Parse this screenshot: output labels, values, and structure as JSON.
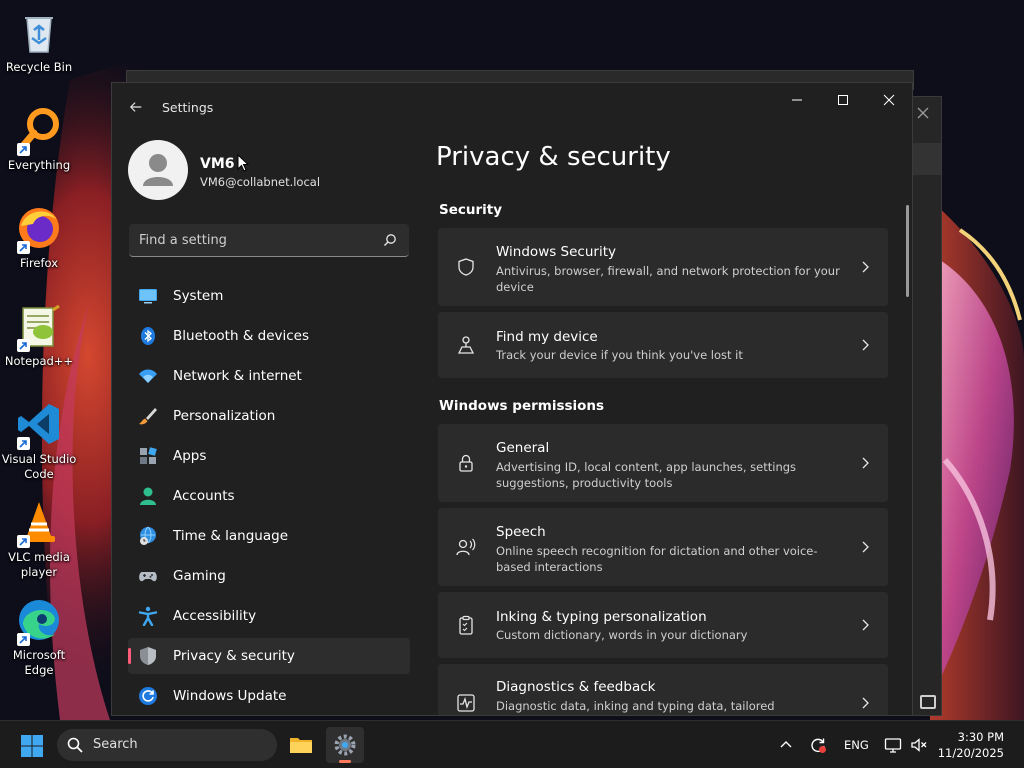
{
  "desktop": {
    "icons": [
      {
        "label": "Recycle Bin",
        "icon": "recycle-bin-icon"
      },
      {
        "label": "Everything",
        "icon": "everything-search-icon"
      },
      {
        "label": "Firefox",
        "icon": "firefox-icon"
      },
      {
        "label": "Notepad++",
        "icon": "notepad-plus-plus-icon"
      },
      {
        "label": "Visual Studio Code",
        "icon": "vscode-icon"
      },
      {
        "label": "VLC media player",
        "icon": "vlc-icon"
      },
      {
        "label": "Microsoft Edge",
        "icon": "edge-icon"
      }
    ]
  },
  "window": {
    "app_title": "Settings"
  },
  "profile": {
    "name": "VM6",
    "email": "VM6@collabnet.local"
  },
  "search": {
    "placeholder": "Find a setting"
  },
  "nav": {
    "items": [
      {
        "label": "System",
        "icon": "monitor-icon"
      },
      {
        "label": "Bluetooth & devices",
        "icon": "bluetooth-icon"
      },
      {
        "label": "Network & internet",
        "icon": "wifi-icon"
      },
      {
        "label": "Personalization",
        "icon": "brush-icon"
      },
      {
        "label": "Apps",
        "icon": "apps-icon"
      },
      {
        "label": "Accounts",
        "icon": "person-icon"
      },
      {
        "label": "Time & language",
        "icon": "globe-clock-icon"
      },
      {
        "label": "Gaming",
        "icon": "gamepad-icon"
      },
      {
        "label": "Accessibility",
        "icon": "accessibility-icon"
      },
      {
        "label": "Privacy & security",
        "icon": "shield-icon",
        "active": true
      },
      {
        "label": "Windows Update",
        "icon": "update-icon"
      }
    ],
    "active_accent": "#ff5c7a"
  },
  "content": {
    "title": "Privacy & security",
    "sections": [
      {
        "title": "Security",
        "cards": [
          {
            "title": "Windows Security",
            "desc": "Antivirus, browser, firewall, and network protection for your device",
            "icon": "shield-outline-icon"
          },
          {
            "title": "Find my device",
            "desc": "Track your device if you think you've lost it",
            "icon": "find-device-icon"
          }
        ]
      },
      {
        "title": "Windows permissions",
        "cards": [
          {
            "title": "General",
            "desc": "Advertising ID, local content, app launches, settings suggestions, productivity tools",
            "icon": "lock-icon"
          },
          {
            "title": "Speech",
            "desc": "Online speech recognition for dictation and other voice-based interactions",
            "icon": "speech-icon"
          },
          {
            "title": "Inking & typing personalization",
            "desc": "Custom dictionary, words in your dictionary",
            "icon": "clipboard-icon"
          },
          {
            "title": "Diagnostics & feedback",
            "desc": "Diagnostic data, inking and typing data, tailored experiences,",
            "icon": "diagnostics-icon"
          }
        ]
      }
    ]
  },
  "taskbar": {
    "search_label": "Search",
    "language": "ENG",
    "time": "3:30 PM",
    "date": "11/20/2025"
  }
}
